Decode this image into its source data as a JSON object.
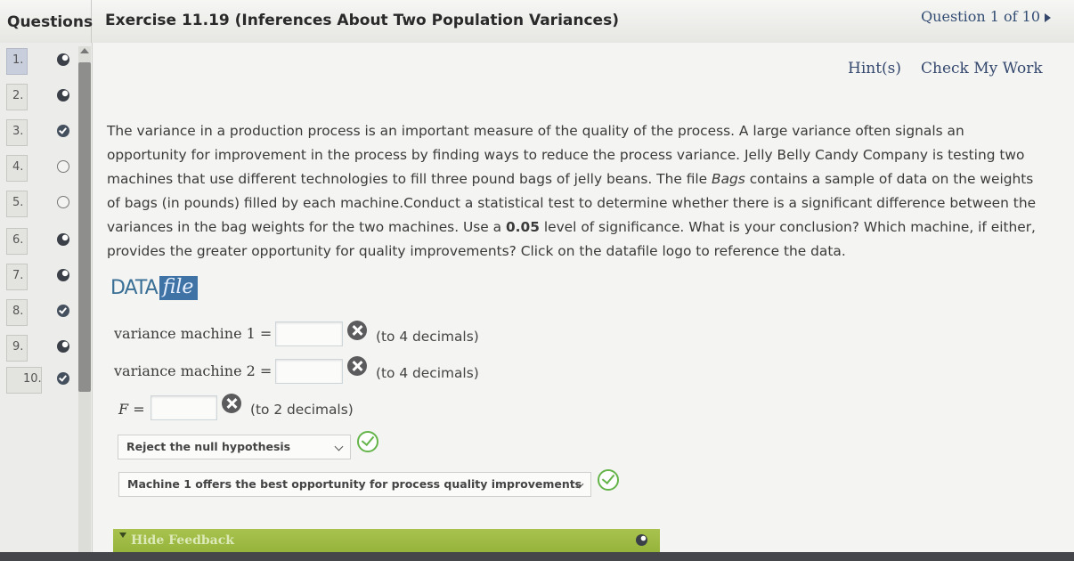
{
  "header": {
    "questions_tab": "Questions",
    "title": "Exercise 11.19 (Inferences About Two Population Variances)",
    "question_nav": "Question 1 of 10"
  },
  "sidebar": {
    "items": [
      {
        "number": "1.",
        "status": "half-complete"
      },
      {
        "number": "2.",
        "status": "half-complete"
      },
      {
        "number": "3.",
        "status": "complete"
      },
      {
        "number": "4.",
        "status": "not-started"
      },
      {
        "number": "5.",
        "status": "not-started"
      },
      {
        "number": "6.",
        "status": "half-complete"
      },
      {
        "number": "7.",
        "status": "half-complete"
      },
      {
        "number": "8.",
        "status": "complete"
      },
      {
        "number": "9.",
        "status": "half-complete"
      },
      {
        "number": "10.",
        "status": "complete"
      }
    ]
  },
  "toolbar": {
    "hint_label": "Hint(s)",
    "check_label": "Check My Work"
  },
  "question": {
    "part1": "The variance in a production process is an important measure of the quality of the process. A large variance often signals an opportunity for improvement in the process by finding ways to reduce the process variance. Jelly Belly Candy Company is testing two machines that use different technologies to fill three pound bags of jelly beans. The file ",
    "file_name": "Bags",
    "part2": " contains a sample of data on the weights of bags (in pounds) filled by each machine.Conduct a statistical test to determine whether there is a significant difference between the variances in the bag weights for the two machines. Use a ",
    "significance": "0.05",
    "part3": " level of significance. What is your conclusion? Which machine, if either, provides the greater opportunity for quality improvements? Click on the datafile logo to reference the data."
  },
  "datafile": {
    "data_label": "DATA",
    "file_label": "file"
  },
  "answers": {
    "var1_label": "variance machine 1 =",
    "var1_value": "",
    "var1_note": "(to 4 decimals)",
    "var2_label": "variance machine 2 =",
    "var2_value": "",
    "var2_note": "(to 4 decimals)",
    "f_label": "F",
    "f_eq": " =",
    "f_value": "",
    "f_note": "(to 2 decimals)",
    "conclusion_select": "Reject the null hypothesis",
    "machine_select": "Machine 1 offers the best opportunity for process quality improvements"
  },
  "feedback": {
    "label": "Hide Feedback"
  },
  "colors": {
    "link": "#34486e",
    "correct": "#64b44a",
    "incorrect": "#5b5b5d",
    "feedback_bar": "#9fbb45",
    "datafile_blue": "#3f73a6"
  }
}
